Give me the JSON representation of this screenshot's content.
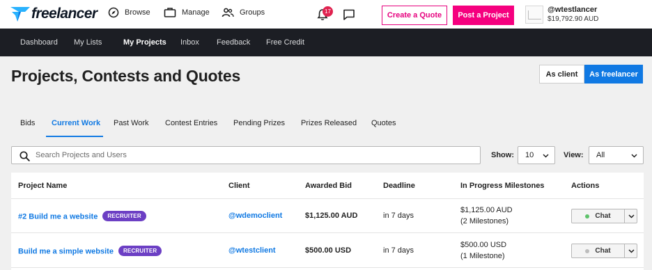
{
  "header": {
    "logo_text": "freelancer",
    "nav": [
      {
        "label": "Browse",
        "icon": "compass-icon"
      },
      {
        "label": "Manage",
        "icon": "briefcase-icon"
      },
      {
        "label": "Groups",
        "icon": "groups-icon"
      }
    ],
    "notification_count": "17",
    "create_quote_label": "Create a Quote",
    "post_project_label": "Post a Project",
    "username": "@wtestlancer",
    "balance": "$19,792.90 AUD"
  },
  "main_nav": {
    "items": [
      "Dashboard",
      "My Lists",
      "My Projects",
      "Inbox",
      "Feedback",
      "Free Credit"
    ],
    "active": "My Projects"
  },
  "page": {
    "title": "Projects, Contests and Quotes",
    "toggle_client": "As client",
    "toggle_freelancer": "As freelancer",
    "tabs": [
      "Bids",
      "Current Work",
      "Past Work",
      "Contest Entries",
      "Pending Prizes",
      "Prizes Released",
      "Quotes"
    ],
    "active_tab": "Current Work"
  },
  "filters": {
    "search_placeholder": "Search Projects and Users",
    "show_label": "Show:",
    "show_value": "10",
    "view_label": "View:",
    "view_value": "All"
  },
  "table": {
    "columns": [
      "Project Name",
      "Client",
      "Awarded Bid",
      "Deadline",
      "In Progress Milestones",
      "Actions"
    ],
    "rows": [
      {
        "project": "#2 Build me a website",
        "tag": "RECRUITER",
        "client": "@wdemoclient",
        "bid": "$1,125.00 AUD",
        "deadline": "in 7 days",
        "milestone_amount": "$1,125.00 AUD",
        "milestone_count": "(2 Milestones)",
        "action": "Chat",
        "online": true
      },
      {
        "project": "Build me a simple website",
        "tag": "RECRUITER",
        "client": "@wtestclient",
        "bid": "$500.00 USD",
        "deadline": "in 7 days",
        "milestone_amount": "$500.00 USD",
        "milestone_count": "(1 Milestone)",
        "action": "Chat",
        "online": false
      }
    ]
  },
  "colors": {
    "primary": "#1079e3",
    "accent": "#f5007f",
    "tag": "#6c3fc4",
    "online": "#5dc26a",
    "offline": "#bdbdbd"
  }
}
